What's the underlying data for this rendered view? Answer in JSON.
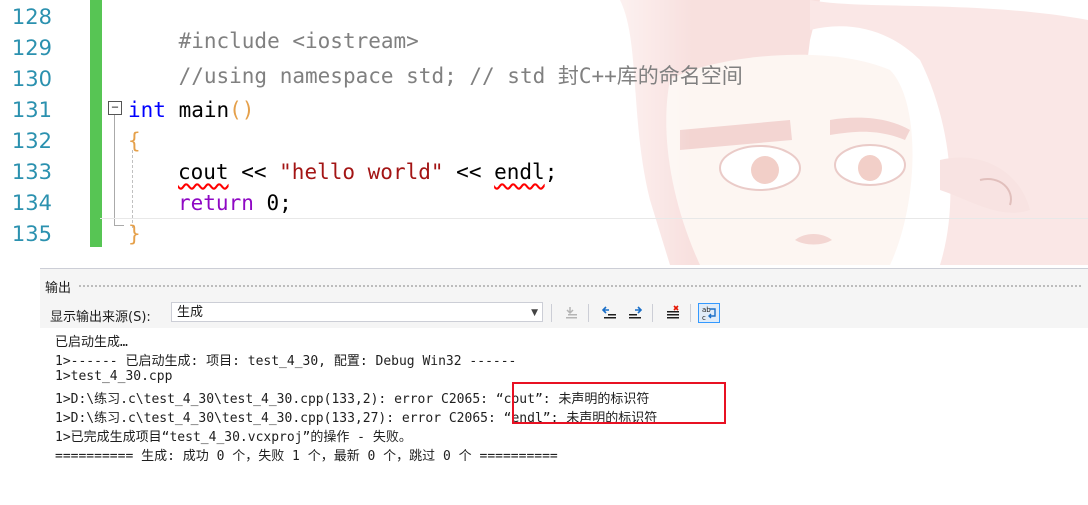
{
  "editor": {
    "line_numbers": [
      "128",
      "129",
      "130",
      "131",
      "132",
      "133",
      "134",
      "135"
    ],
    "lines": {
      "l128": "#include <iostream>",
      "l129": "//using namespace std; // std 封C++库的命名空间",
      "l131_kw": "int",
      "l131_rest": " main",
      "l131_paren": "()",
      "l132_brace": "{",
      "l133_cout": "cout",
      "l133_op1": " << ",
      "l133_str": "\"hello world\"",
      "l133_op2": " << ",
      "l133_endl": "endl",
      "l133_semi": ";",
      "l134_kw": "return",
      "l134_rest": " 0;",
      "l135_brace": "}"
    },
    "fold_glyph": "−"
  },
  "output": {
    "title": "输出",
    "source_label": "显示输出来源(S):",
    "source_value": "生成",
    "lines": [
      "已启动生成…",
      "1>------ 已启动生成: 项目: test_4_30, 配置: Debug Win32 ------",
      "1>test_4_30.cpp",
      "1>D:\\练习.c\\test_4_30\\test_4_30.cpp(133,2): error C2065: “cout”: 未声明的标识符",
      "1>D:\\练习.c\\test_4_30\\test_4_30.cpp(133,27): error C2065: “endl”: 未声明的标识符",
      "1>已完成生成项目“test_4_30.vcxproj”的操作 - 失败。",
      "========== 生成: 成功 0 个，失败 1 个，最新 0 个，跳过 0 个 =========="
    ]
  },
  "colors": {
    "line_number": "#2b91af",
    "keyword": "#0000ff",
    "comment": "#808080",
    "string": "#a31515",
    "change_bar": "#57c554",
    "highlight_border": "#e81123"
  }
}
